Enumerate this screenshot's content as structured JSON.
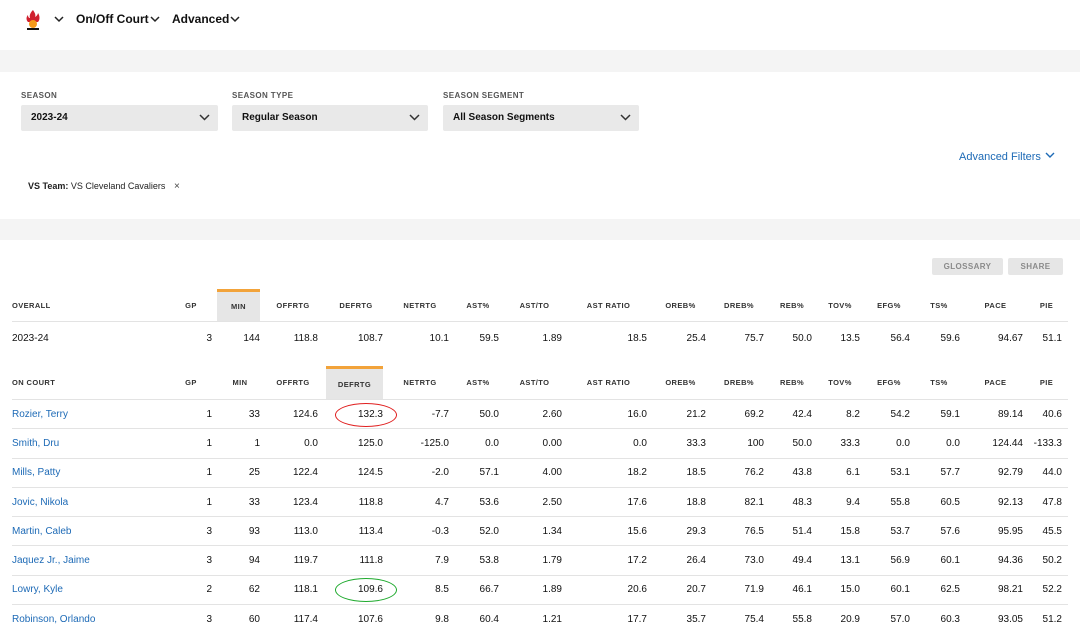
{
  "nav": {
    "team_logo_icon": "miami-heat-logo",
    "items": [
      {
        "label": "On/Off Court"
      },
      {
        "label": "Advanced"
      }
    ]
  },
  "filters": {
    "season": {
      "label": "SEASON",
      "value": "2023-24"
    },
    "season_type": {
      "label": "SEASON TYPE",
      "value": "Regular Season"
    },
    "season_segment": {
      "label": "SEASON SEGMENT",
      "value": "All Season Segments"
    },
    "advanced_filters_label": "Advanced Filters",
    "active_chip": {
      "key": "VS Team:",
      "value": "VS Cleveland Cavaliers",
      "remove": "×"
    }
  },
  "toolbar": {
    "glossary_label": "GLOSSARY",
    "share_label": "SHARE"
  },
  "overall": {
    "headers": [
      "OVERALL",
      "GP",
      "MIN",
      "OFFRTG",
      "DEFRTG",
      "NETRTG",
      "AST%",
      "AST/TO",
      "AST RATIO",
      "OREB%",
      "DREB%",
      "REB%",
      "TOV%",
      "EFG%",
      "TS%",
      "PACE",
      "PIE"
    ],
    "sorted_column": "MIN",
    "row": [
      "2023-24",
      "3",
      "144",
      "118.8",
      "108.7",
      "10.1",
      "59.5",
      "1.89",
      "18.5",
      "25.4",
      "75.7",
      "50.0",
      "13.5",
      "56.4",
      "59.6",
      "94.67",
      "51.1"
    ]
  },
  "on_court": {
    "headers": [
      "ON COURT",
      "GP",
      "MIN",
      "OFFRTG",
      "DEFRTG",
      "NETRTG",
      "AST%",
      "AST/TO",
      "AST RATIO",
      "OREB%",
      "DREB%",
      "REB%",
      "TOV%",
      "EFG%",
      "TS%",
      "PACE",
      "PIE"
    ],
    "sorted_column": "DEFRTG",
    "rows": [
      [
        "Rozier, Terry",
        "1",
        "33",
        "124.6",
        "132.3",
        "-7.7",
        "50.0",
        "2.60",
        "16.0",
        "21.2",
        "69.2",
        "42.4",
        "8.2",
        "54.2",
        "59.1",
        "89.14",
        "40.6"
      ],
      [
        "Smith, Dru",
        "1",
        "1",
        "0.0",
        "125.0",
        "-125.0",
        "0.0",
        "0.00",
        "0.0",
        "33.3",
        "100",
        "50.0",
        "33.3",
        "0.0",
        "0.0",
        "124.44",
        "-133.3"
      ],
      [
        "Mills, Patty",
        "1",
        "25",
        "122.4",
        "124.5",
        "-2.0",
        "57.1",
        "4.00",
        "18.2",
        "18.5",
        "76.2",
        "43.8",
        "6.1",
        "53.1",
        "57.7",
        "92.79",
        "44.0"
      ],
      [
        "Jovic, Nikola",
        "1",
        "33",
        "123.4",
        "118.8",
        "4.7",
        "53.6",
        "2.50",
        "17.6",
        "18.8",
        "82.1",
        "48.3",
        "9.4",
        "55.8",
        "60.5",
        "92.13",
        "47.8"
      ],
      [
        "Martin, Caleb",
        "3",
        "93",
        "113.0",
        "113.4",
        "-0.3",
        "52.0",
        "1.34",
        "15.6",
        "29.3",
        "76.5",
        "51.4",
        "15.8",
        "53.7",
        "57.6",
        "95.95",
        "45.5"
      ],
      [
        "Jaquez Jr., Jaime",
        "3",
        "94",
        "119.7",
        "111.8",
        "7.9",
        "53.8",
        "1.79",
        "17.2",
        "26.4",
        "73.0",
        "49.4",
        "13.1",
        "56.9",
        "60.1",
        "94.36",
        "50.2"
      ],
      [
        "Lowry, Kyle",
        "2",
        "62",
        "118.1",
        "109.6",
        "8.5",
        "66.7",
        "1.89",
        "20.6",
        "20.7",
        "71.9",
        "46.1",
        "15.0",
        "60.1",
        "62.5",
        "98.21",
        "52.2"
      ],
      [
        "Robinson, Orlando",
        "3",
        "60",
        "117.4",
        "107.6",
        "9.8",
        "60.4",
        "1.21",
        "17.7",
        "35.7",
        "75.4",
        "55.8",
        "20.9",
        "57.0",
        "60.3",
        "93.05",
        "51.2"
      ]
    ]
  },
  "annotations": [
    {
      "row_player": "Rozier, Terry",
      "column": "DEFRTG",
      "color": "#e02020"
    },
    {
      "row_player": "Lowry, Kyle",
      "column": "DEFRTG",
      "color": "#1faa2e"
    }
  ],
  "colors": {
    "link": "#1d6ab6",
    "sort_accent": "#f2a33a"
  }
}
